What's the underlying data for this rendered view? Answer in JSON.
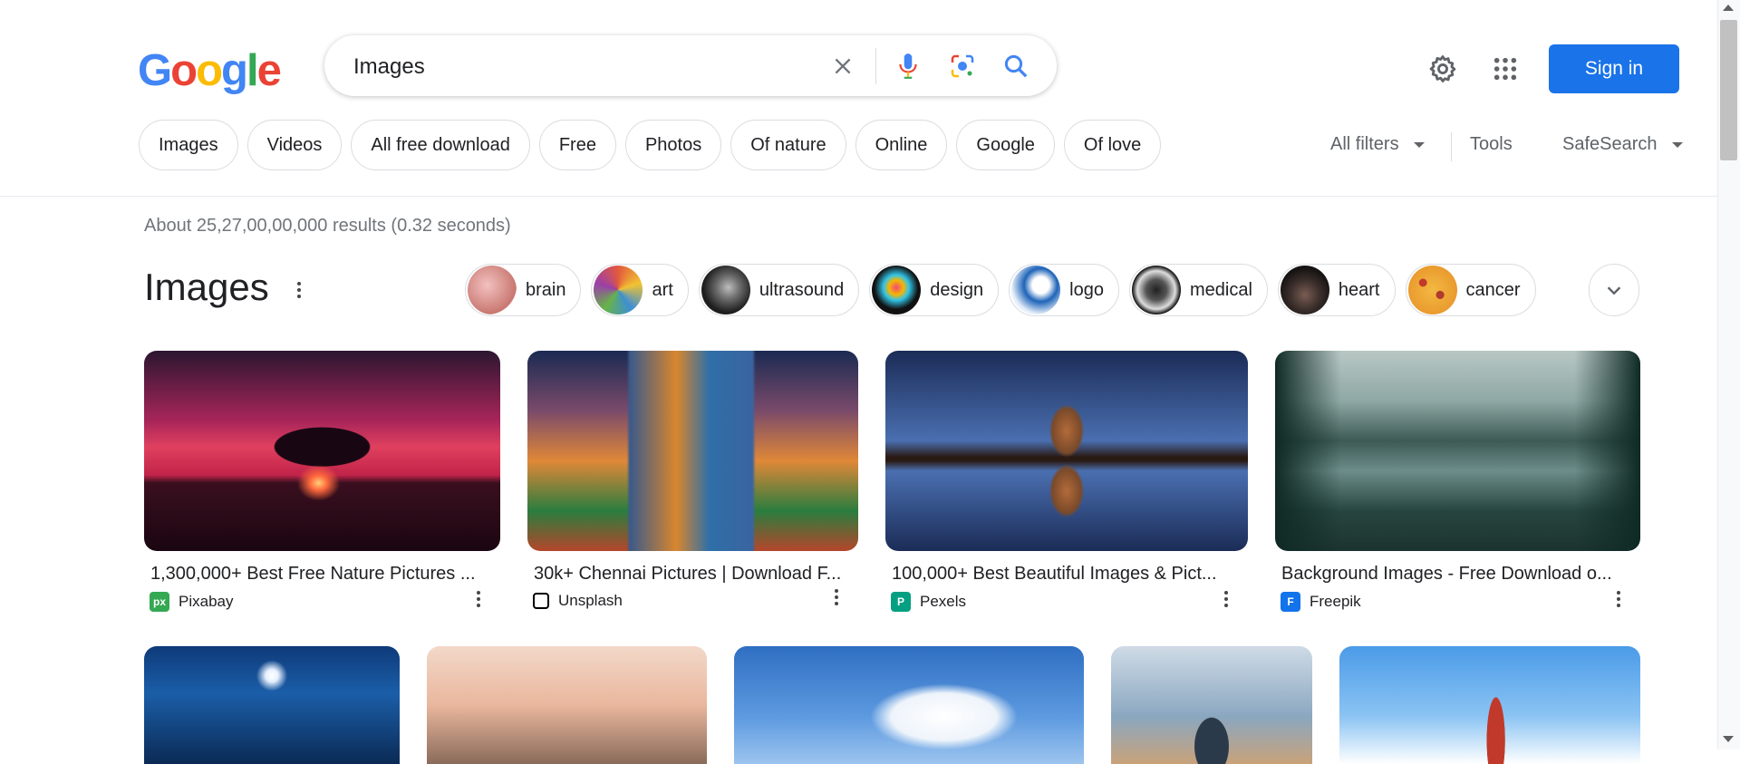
{
  "logo": {
    "letters": [
      "G",
      "o",
      "o",
      "g",
      "l",
      "e"
    ],
    "colors": [
      "#4285f4",
      "#ea4335",
      "#fbbc05",
      "#4285f4",
      "#34a853",
      "#ea4335"
    ]
  },
  "search": {
    "value": "Images",
    "icons": [
      "close-icon",
      "microphone-icon",
      "lens-icon",
      "search-icon"
    ]
  },
  "header": {
    "settings_icon": "gear-icon",
    "apps_icon": "grid-icon",
    "signin_label": "Sign in"
  },
  "filter_chips": [
    "Images",
    "Videos",
    "All free download",
    "Free",
    "Photos",
    "Of nature",
    "Online",
    "Google",
    "Of love"
  ],
  "tools": {
    "all_filters": "All filters",
    "tools": "Tools",
    "safesearch": "SafeSearch"
  },
  "results_text": "About 25,27,00,00,000 results (0.32 seconds)",
  "images_heading": "Images",
  "related_chips": [
    "brain",
    "art",
    "ultrasound",
    "design",
    "logo",
    "medical",
    "heart",
    "cancer"
  ],
  "cards": [
    {
      "title": "1,300,000+ Best Free Nature Pictures ...",
      "source": "Pixabay",
      "fav": "px"
    },
    {
      "title": "30k+ Chennai Pictures | Download F...",
      "source": "Unsplash",
      "fav": ""
    },
    {
      "title": "100,000+ Best Beautiful Images & Pict...",
      "source": "Pexels",
      "fav": "P"
    },
    {
      "title": "Background Images - Free Download o...",
      "source": "Freepik",
      "fav": "F"
    }
  ],
  "accent": "#1a73e8"
}
